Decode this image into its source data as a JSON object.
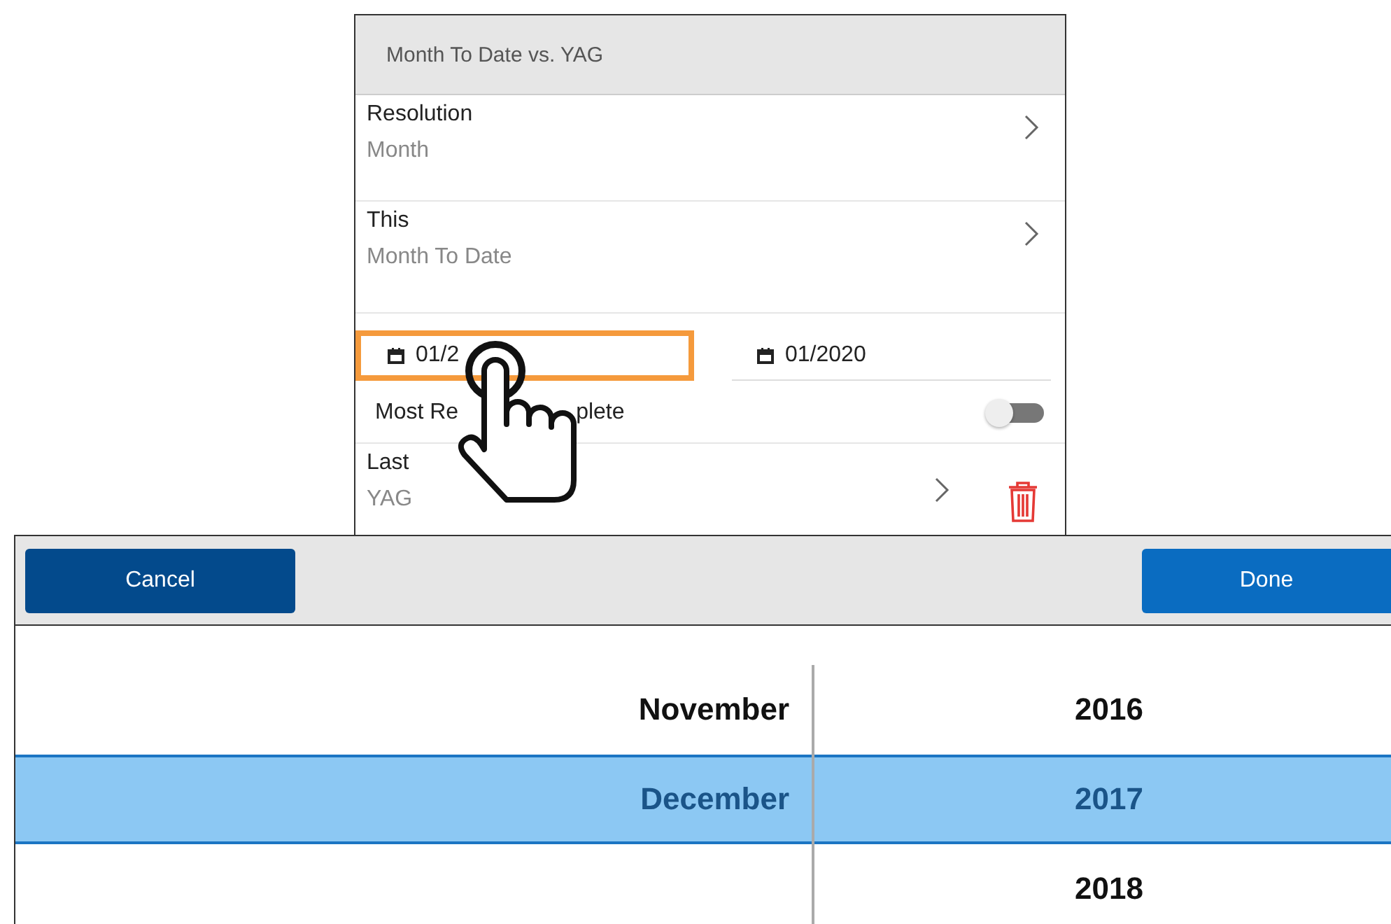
{
  "panel": {
    "title": "Month To Date vs. YAG",
    "rows": [
      {
        "label": "Resolution",
        "value": "Month"
      },
      {
        "label": "This",
        "value": "Month To Date"
      }
    ],
    "date_fields": [
      {
        "value": "01/2",
        "highlighted": true
      },
      {
        "value": "01/2020",
        "highlighted": false
      }
    ],
    "toggle": {
      "label_parts": [
        "Most Re",
        "plete"
      ],
      "on": false
    },
    "last_row": {
      "label": "Last",
      "value": "YAG"
    }
  },
  "picker": {
    "buttons": [
      "Cancel",
      "Done"
    ],
    "months": [
      {
        "label": "November",
        "selected": false
      },
      {
        "label": "December",
        "selected": true
      }
    ],
    "years": [
      {
        "label": "2016",
        "selected": false
      },
      {
        "label": "2017",
        "selected": true
      },
      {
        "label": "2018",
        "selected": false
      }
    ]
  }
}
